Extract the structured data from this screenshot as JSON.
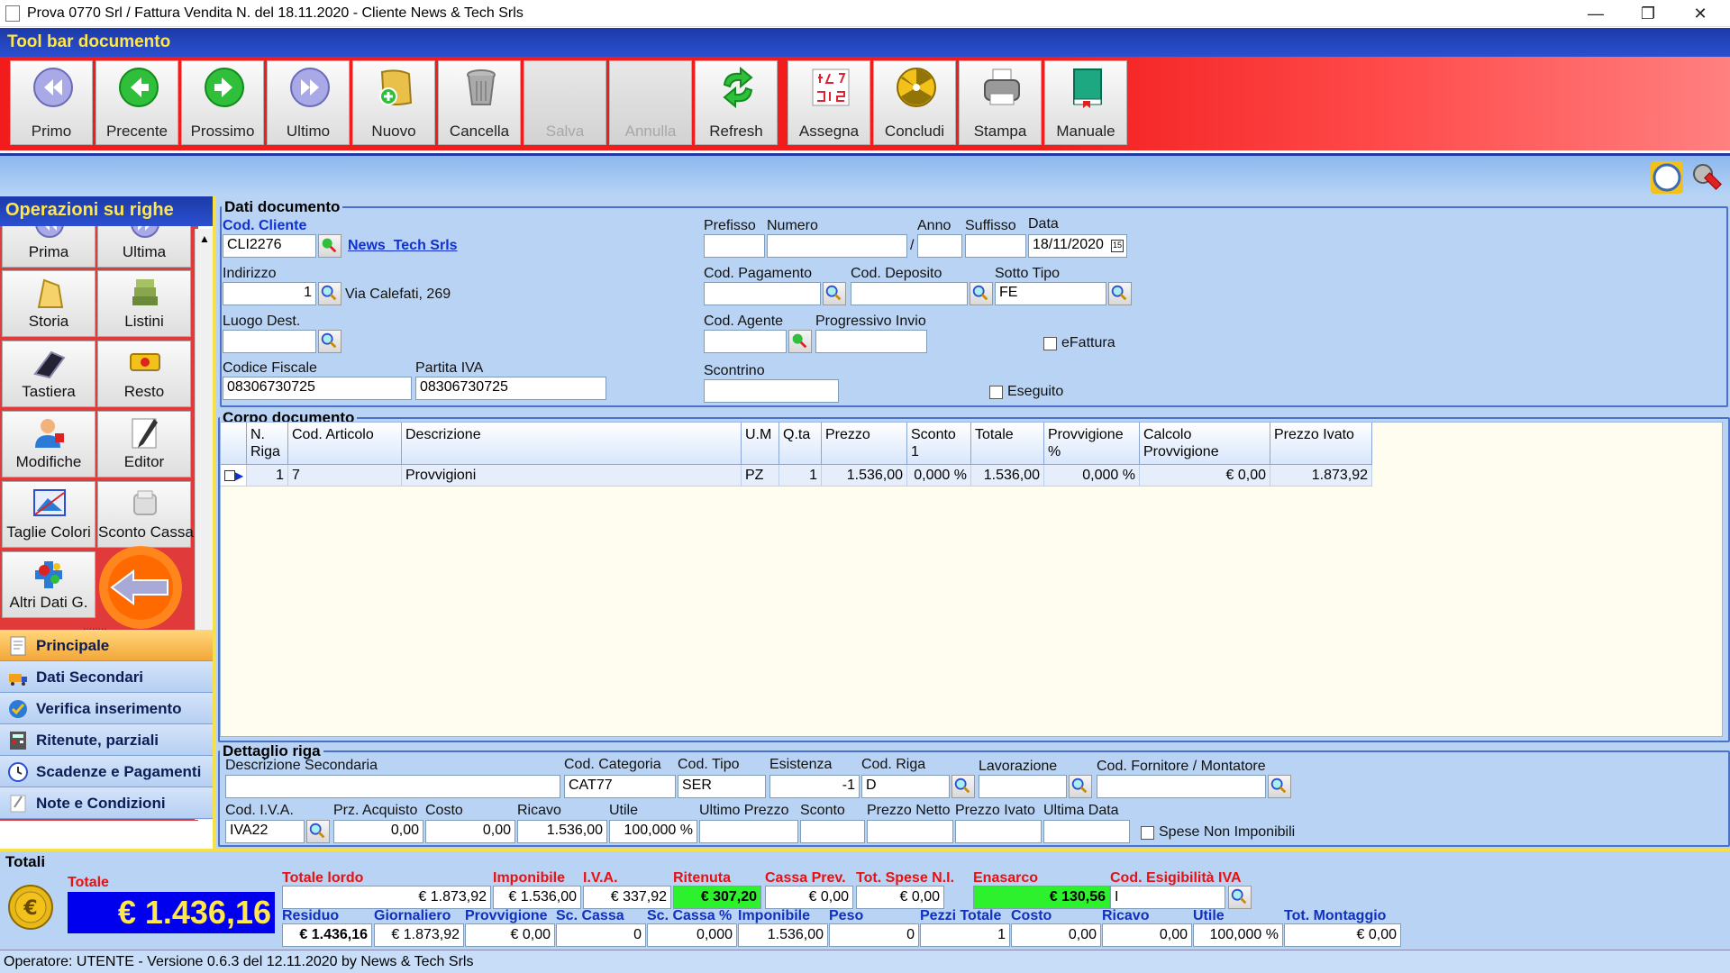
{
  "window": {
    "title": "Prova 0770 Srl / Fattura Vendita N.  del 18.11.2020 - Cliente News & Tech Srls",
    "minimize": "—",
    "restore": "❐",
    "close": "✕"
  },
  "toolbar": {
    "title": "Tool bar documento",
    "buttons": [
      {
        "label": "Primo",
        "icon": "first-record-icon"
      },
      {
        "label": "Precente",
        "icon": "previous-record-icon"
      },
      {
        "label": "Prossimo",
        "icon": "next-record-icon"
      },
      {
        "label": "Ultimo",
        "icon": "last-record-icon"
      },
      {
        "label": "Nuovo",
        "icon": "new-document-icon"
      },
      {
        "label": "Cancella",
        "icon": "trash-icon"
      },
      {
        "label": "Salva",
        "icon": "save-icon",
        "disabled": true
      },
      {
        "label": "Annulla",
        "icon": "undo-icon",
        "disabled": true
      },
      {
        "label": "Refresh",
        "icon": "refresh-icon"
      },
      {
        "label": "Assegna",
        "icon": "numbers-icon"
      },
      {
        "label": "Concludi",
        "icon": "conclude-icon"
      },
      {
        "label": "Stampa",
        "icon": "printer-icon"
      },
      {
        "label": "Manuale",
        "icon": "book-icon"
      }
    ],
    "grip": "..........",
    "colors": {
      "header": "#1c3aa8",
      "header_text": "#ffe64a",
      "strip": "#f21c1c"
    }
  },
  "operations": {
    "title": "Operazioni su righe",
    "buttons": [
      {
        "label": "Prima",
        "icon": "first-row-icon"
      },
      {
        "label": "Ultima",
        "icon": "last-row-icon"
      },
      {
        "label": "Storia",
        "icon": "history-icon"
      },
      {
        "label": "Listini",
        "icon": "price-list-icon"
      },
      {
        "label": "Tastiera",
        "icon": "keyboard-icon"
      },
      {
        "label": "Resto",
        "icon": "change-money-icon"
      },
      {
        "label": "Modifiche",
        "icon": "user-edit-icon"
      },
      {
        "label": "Editor",
        "icon": "pencil-icon"
      },
      {
        "label": "Taglie Colori",
        "icon": "sizes-colors-icon"
      },
      {
        "label": "Sconto Cassa",
        "icon": "cash-discount-icon"
      },
      {
        "label": "Altri Dati G.",
        "icon": "puzzle-icon"
      }
    ],
    "grip": "........"
  },
  "nav": {
    "items": [
      {
        "label": "Principale",
        "icon": "document-icon",
        "active": true
      },
      {
        "label": "Dati Secondari",
        "icon": "truck-icon"
      },
      {
        "label": "Verifica inserimento",
        "icon": "check-icon"
      },
      {
        "label": "Ritenute, parziali",
        "icon": "calculator-icon"
      },
      {
        "label": "Scadenze e Pagamenti",
        "icon": "clock-icon"
      },
      {
        "label": "Note e Condizioni",
        "icon": "note-icon"
      }
    ]
  },
  "doc": {
    "legend": "Dati documento",
    "cod_cliente_label": "Cod. Cliente",
    "cod_cliente": "CLI2276",
    "cliente_link": "News_Tech Srls",
    "indirizzo_label": "Indirizzo",
    "indirizzo_num": "1",
    "indirizzo": "Via Calefati, 269",
    "luogo_label": "Luogo Dest.",
    "luogo": "",
    "cf_label": "Codice Fiscale",
    "cf": "08306730725",
    "piva_label": "Partita IVA",
    "piva": "08306730725",
    "prefisso_label": "Prefisso",
    "numero_label": "Numero",
    "anno_label": "Anno",
    "suffisso_label": "Suffisso",
    "data_label": "Data",
    "slash": "/",
    "data": "18/11/2020",
    "cod_pag_label": "Cod. Pagamento",
    "cod_dep_label": "Cod. Deposito",
    "sotto_tipo_label": "Sotto Tipo",
    "sotto_tipo": "FE",
    "cod_agente_label": "Cod. Agente",
    "prog_invio_label": "Progressivo Invio",
    "efattura_label": "eFattura",
    "scontrino_label": "Scontrino",
    "eseguito_label": "Eseguito"
  },
  "body": {
    "legend": "Corpo documento",
    "columns": [
      "N. Riga",
      "Cod. Articolo",
      "Descrizione",
      "U.M",
      "Q.ta",
      "Prezzo",
      "Sconto 1",
      "Totale",
      "Provvigione %",
      "Calcolo Provvigione",
      "Prezzo Ivato"
    ],
    "rows": [
      [
        "1",
        "7",
        "Provvigioni",
        "PZ",
        "1",
        "1.536,00",
        "0,000 %",
        "1.536,00",
        "0,000 %",
        "€ 0,00",
        "1.873,92"
      ]
    ]
  },
  "detail": {
    "legend": "Dettaglio riga",
    "desc_sec_label": "Descrizione Secondaria",
    "cod_cat_label": "Cod. Categoria",
    "cod_cat": "CAT77",
    "cod_tipo_label": "Cod. Tipo",
    "cod_tipo": "SER",
    "esistenza_label": "Esistenza",
    "esistenza": "-1",
    "cod_riga_label": "Cod. Riga",
    "cod_riga": "D",
    "lavorazione_label": "Lavorazione",
    "fornitore_label": "Cod. Fornitore / Montatore",
    "iva_label": "Cod. I.V.A.",
    "iva": "IVA22",
    "prz_acq_label": "Prz. Acquisto",
    "prz_acq": "0,00",
    "costo_label": "Costo",
    "costo": "0,00",
    "ricavo_label": "Ricavo",
    "ricavo": "1.536,00",
    "utile_label": "Utile",
    "utile": "100,000 %",
    "ultimo_prezzo_label": "Ultimo Prezzo",
    "sconto_label": "Sconto",
    "prezzo_netto_label": "Prezzo Netto",
    "prezzo_ivato_label": "Prezzo Ivato",
    "ultima_data_label": "Ultima Data",
    "spese_label": "Spese Non Imponibili"
  },
  "totals": {
    "legend": "Totali",
    "totale_label": "Totale",
    "totale": "€ 1.436,16",
    "row1": [
      {
        "label": "Totale lordo",
        "value": "€ 1.873,92"
      },
      {
        "label": "Imponibile",
        "value": "€ 1.536,00"
      },
      {
        "label": "I.V.A.",
        "value": "€ 337,92"
      },
      {
        "label": "Ritenuta",
        "value": "€ 307,20",
        "green": true
      },
      {
        "label": "Cassa Prev.",
        "value": "€ 0,00"
      },
      {
        "label": "Tot. Spese N.I.",
        "value": "€ 0,00"
      },
      {
        "label": "Enasarco",
        "value": "€ 130,56",
        "green": true
      },
      {
        "label": "Cod. Esigibilità IVA",
        "value": "I"
      }
    ],
    "row2": [
      {
        "label": "Residuo",
        "value": "€ 1.436,16"
      },
      {
        "label": "Giornaliero",
        "value": "€ 1.873,92"
      },
      {
        "label": "Provvigione",
        "value": "€ 0,00"
      },
      {
        "label": "Sc. Cassa",
        "value": "0"
      },
      {
        "label": "Sc. Cassa %",
        "value": "0,000"
      },
      {
        "label": "Imponibile",
        "value": "1.536,00"
      },
      {
        "label": "Peso",
        "value": "0"
      },
      {
        "label": "Pezzi Totale",
        "value": "1"
      },
      {
        "label": "Costo",
        "value": "0,00"
      },
      {
        "label": "Ricavo",
        "value": "0,00"
      },
      {
        "label": "Utile",
        "value": "100,000 %"
      },
      {
        "label": "Tot. Montaggio",
        "value": "€ 0,00"
      }
    ]
  },
  "status": {
    "text": "Operatore: UTENTE - Versione 0.6.3 del 12.11.2020 by News & Tech Srls"
  }
}
